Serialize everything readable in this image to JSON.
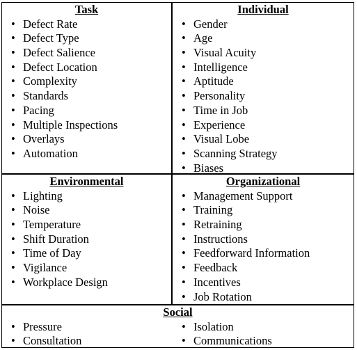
{
  "table": {
    "task": {
      "header": "Task",
      "items": [
        "Defect Rate",
        "Defect Type",
        "Defect Salience",
        "Defect Location",
        "Complexity",
        "Standards",
        "Pacing",
        "Multiple Inspections",
        "Overlays",
        "Automation"
      ]
    },
    "individual": {
      "header": "Individual",
      "items": [
        "Gender",
        "Age",
        "Visual Acuity",
        "Intelligence",
        "Aptitude",
        "Personality",
        "Time in Job",
        "Experience",
        "Visual Lobe",
        "Scanning Strategy",
        "Biases"
      ]
    },
    "environmental": {
      "header": "Environmental",
      "items": [
        "Lighting",
        "Noise",
        "Temperature",
        "Shift Duration",
        "Time of Day",
        "Vigilance",
        "Workplace Design"
      ]
    },
    "organizational": {
      "header": "Organizational",
      "items": [
        "Management Support",
        "Training",
        "Retraining",
        "Instructions",
        "Feedforward Information",
        "Feedback",
        "Incentives",
        "Job Rotation"
      ]
    },
    "social": {
      "header": "Social",
      "items_left": [
        "Pressure",
        "Consultation"
      ],
      "items_right": [
        "Isolation",
        "Communications"
      ]
    }
  }
}
